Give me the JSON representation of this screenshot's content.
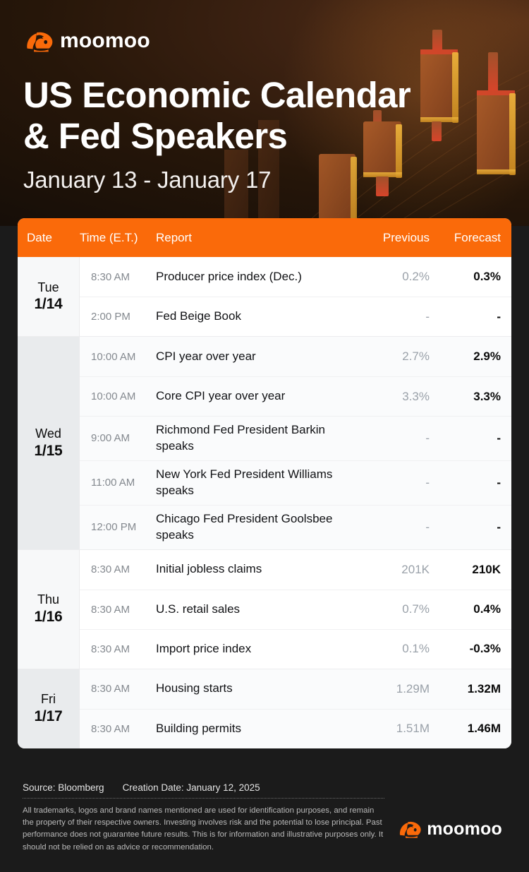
{
  "brand": {
    "name": "moomoo",
    "logo_icon": "moomoo-bull-logo",
    "accent_color": "#FA6A0A"
  },
  "hero": {
    "title_line1": "US Economic Calendar",
    "title_line2": "& Fed Speakers",
    "date_range": "January 13 - January 17"
  },
  "table": {
    "columns": {
      "date": "Date",
      "time": "Time (E.T.)",
      "report": "Report",
      "previous": "Previous",
      "forecast": "Forecast"
    },
    "days": [
      {
        "dow": "Tue",
        "date": "1/14",
        "shade": "light",
        "rows": [
          {
            "time": "8:30 AM",
            "report": "Producer price index (Dec.)",
            "previous": "0.2%",
            "forecast": "0.3%"
          },
          {
            "time": "2:00 PM",
            "report": "Fed Beige Book",
            "previous": "-",
            "forecast": "-"
          }
        ]
      },
      {
        "dow": "Wed",
        "date": "1/15",
        "shade": "dark",
        "rows": [
          {
            "time": "10:00 AM",
            "report": "CPI year over year",
            "previous": "2.7%",
            "forecast": "2.9%"
          },
          {
            "time": "10:00 AM",
            "report": "Core CPI year over year",
            "previous": "3.3%",
            "forecast": "3.3%"
          },
          {
            "time": "9:00 AM",
            "report": "Richmond Fed President Barkin speaks",
            "previous": "-",
            "forecast": "-"
          },
          {
            "time": "11:00 AM",
            "report": "New York Fed President Williams speaks",
            "previous": "-",
            "forecast": "-"
          },
          {
            "time": "12:00 PM",
            "report": "Chicago Fed President Goolsbee speaks",
            "previous": "-",
            "forecast": "-"
          }
        ]
      },
      {
        "dow": "Thu",
        "date": "1/16",
        "shade": "light",
        "rows": [
          {
            "time": "8:30 AM",
            "report": "Initial jobless claims",
            "previous": "201K",
            "forecast": "210K"
          },
          {
            "time": "8:30 AM",
            "report": "U.S. retail sales",
            "previous": "0.7%",
            "forecast": "0.4%"
          },
          {
            "time": "8:30 AM",
            "report": "Import price index",
            "previous": "0.1%",
            "forecast": "-0.3%"
          }
        ]
      },
      {
        "dow": "Fri",
        "date": "1/17",
        "shade": "dark",
        "rows": [
          {
            "time": "8:30 AM",
            "report": "Housing starts",
            "previous": "1.29M",
            "forecast": "1.32M"
          },
          {
            "time": "8:30 AM",
            "report": "Building permits",
            "previous": "1.51M",
            "forecast": "1.46M"
          }
        ]
      }
    ]
  },
  "footer": {
    "source": "Source: Bloomberg",
    "creation_date": "Creation Date: January 12, 2025",
    "disclaimer": "All trademarks, logos and brand names mentioned are used for identification purposes, and remain the property of their respective owners. Investing involves risk and the potential to lose principal. Past performance does not guarantee future results. This is for information and illustrative purposes only. It should not be relied on as advice or recommendation.",
    "logo_text": "moomoo"
  }
}
